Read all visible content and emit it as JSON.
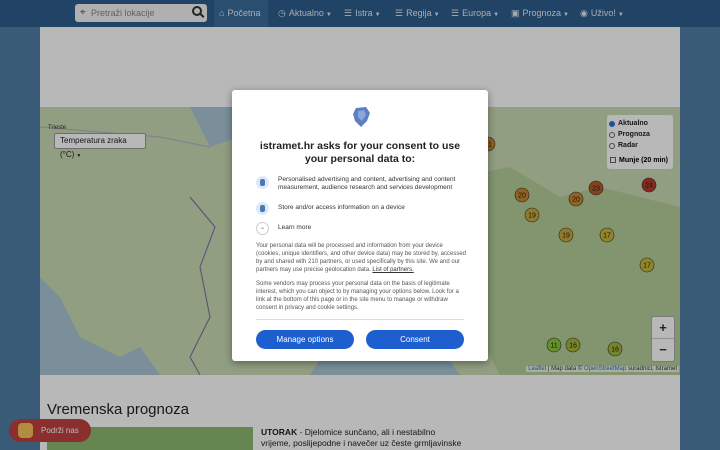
{
  "navbar": {
    "search_placeholder": "Pretraži lokacije",
    "items": [
      {
        "label": "Početna",
        "icon": "home-icon"
      },
      {
        "label": "Aktualno",
        "icon": "clock-icon"
      },
      {
        "label": "Istra",
        "icon": "list-icon"
      },
      {
        "label": "Regija",
        "icon": "list-icon"
      },
      {
        "label": "Europa",
        "icon": "list-icon"
      },
      {
        "label": "Prognoza",
        "icon": "image-icon"
      },
      {
        "label": "Uživo!",
        "icon": "user-icon"
      }
    ]
  },
  "map": {
    "temp_select": "Temperatura zraka (°C)",
    "layers": [
      "Aktualno",
      "Prognoza",
      "Radar"
    ],
    "layer_selected": "Aktualno",
    "lightning": "Munje (20 min)",
    "zoom_in": "+",
    "zoom_out": "−",
    "attribution_leaflet": "Leaflet",
    "attribution_mid": "| Map data ©",
    "attribution_osm": "OpenStreetMap",
    "attribution_end": "suradnici, Istramet",
    "place_label": "Trieste",
    "markers": [
      {
        "v": "21",
        "c": "#c9882e"
      },
      {
        "v": "20",
        "c": "#c9882e"
      },
      {
        "v": "19",
        "c": "#c9a93a"
      },
      {
        "v": "20",
        "c": "#c9882e"
      },
      {
        "v": "19",
        "c": "#c9a93a"
      },
      {
        "v": "17",
        "c": "#c9b93a"
      },
      {
        "v": "23",
        "c": "#b85a2a"
      },
      {
        "v": "24",
        "c": "#b83a2a"
      },
      {
        "v": "17",
        "c": "#c9b93a"
      },
      {
        "v": "16",
        "c": "#a6b83a"
      },
      {
        "v": "11",
        "c": "#8cc63a"
      },
      {
        "v": "16",
        "c": "#a6b83a"
      }
    ]
  },
  "forecast": {
    "heading": "Vremenska prognoza",
    "day": "UTORAK",
    "text": " - Djelomice sunčano, ali i nestabilno vrijeme, poslijepodne i navečer uz česte grmljavinske"
  },
  "support": {
    "label": "Podrži nas"
  },
  "consent": {
    "logo_text": "istramet",
    "title": "istramet.hr asks for your consent to use your personal data to:",
    "purposes": [
      "Personalised advertising and content, advertising and content measurement, audience research and services development",
      "Store and/or access information on a device"
    ],
    "learn_more": "Learn more",
    "body1": "Your personal data will be processed and information from your device (cookies, unique identifiers, and other device data) may be stored by, accessed by and shared with 210 partners, or used specifically by this site. We and our partners may use precise geolocation data.",
    "list_link": "List of partners.",
    "body2": "Some vendors may process your personal data on the basis of legitimate interest, which you can object to by managing your options below. Look for a link at the bottom of this page or in the site menu to manage or withdraw consent in privacy and cookie settings.",
    "manage_button": "Manage options",
    "consent_button": "Consent"
  }
}
